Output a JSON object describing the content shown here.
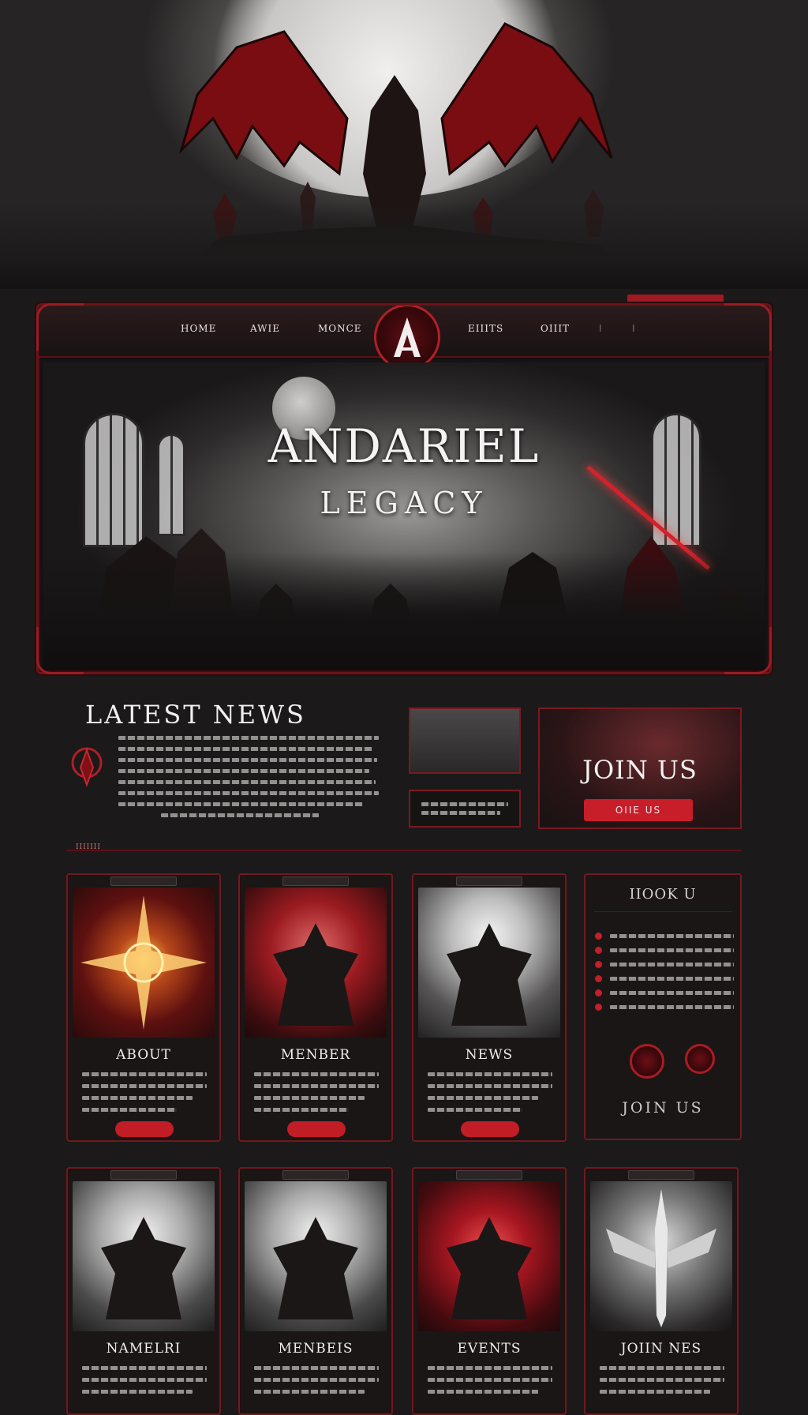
{
  "hero": {
    "title": "ANDARIEL",
    "subtitle": "LEGACY"
  },
  "nav": {
    "items": [
      {
        "label": "HOME"
      },
      {
        "label": "AWIE"
      },
      {
        "label": "MONCE"
      },
      {
        "label": "EIIITS"
      },
      {
        "label": "OIIIT"
      }
    ]
  },
  "news": {
    "title": "LATEST NEWS",
    "divider_label": "IIIIIII"
  },
  "join_box": {
    "title": "JOIN US",
    "button_label": "OIIE US"
  },
  "cards": [
    {
      "title": "ABOUT",
      "art": "gold"
    },
    {
      "title": "MENBER",
      "art": "red"
    },
    {
      "title": "NEWS",
      "art": "grey"
    },
    {
      "title": "NAMELRI",
      "art": "grey2"
    },
    {
      "title": "MENBEIS",
      "art": "grey2"
    },
    {
      "title": "EVENTS",
      "art": "red2"
    },
    {
      "title": "JOIIN NES",
      "art": "silver"
    }
  ],
  "side_panel": {
    "title": "IIOOK U",
    "join_label": "JOIN US"
  },
  "colors": {
    "accent": "#c81e2a",
    "frame": "#6f1a20",
    "background": "#1b1919"
  }
}
